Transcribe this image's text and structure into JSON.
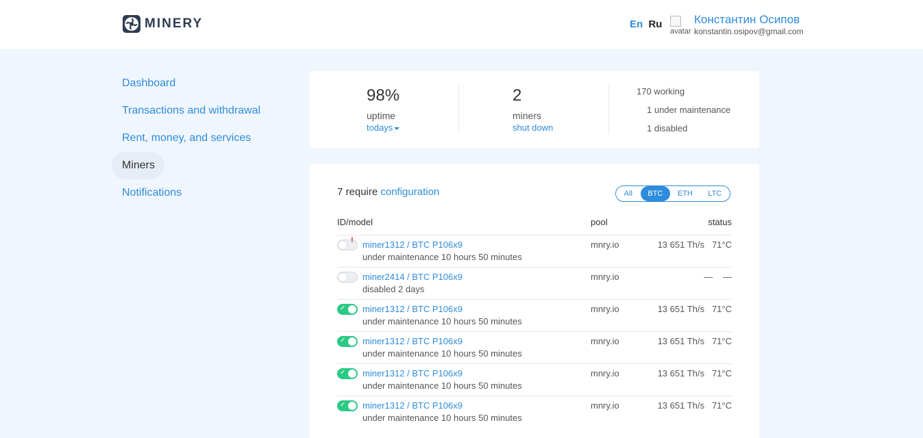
{
  "header": {
    "logo_text": "MINERY",
    "lang_en": "En",
    "lang_ru": "Ru",
    "avatar_alt": "avatar",
    "user_name": "Константин Осипов",
    "user_email": "konstantin.osipov@gmail.com"
  },
  "nav": {
    "items": [
      {
        "label": "Dashboard"
      },
      {
        "label": "Transactions and withdrawal"
      },
      {
        "label": "Rent, money, and services"
      },
      {
        "label": "Miners"
      },
      {
        "label": "Notifications"
      }
    ],
    "active": "Miners"
  },
  "stats": {
    "uptime_value": "98%",
    "uptime_label": "uptime",
    "uptime_period": "todays",
    "miners_value": "2",
    "miners_label": "miners",
    "miners_state": "shut down",
    "working": "170 working",
    "maintenance": "1 under maintenance",
    "disabled": "1 disabled"
  },
  "list": {
    "require_prefix": "7 require",
    "require_link": "configuration",
    "filters": [
      "All",
      "BTC",
      "ETH",
      "LTC"
    ],
    "active_filter": "BTC",
    "col_id": "ID/model",
    "col_pool": "pool",
    "col_status": "status",
    "rows": [
      {
        "enabled": false,
        "warning": "!",
        "name": "miner1312 / BTC P106x9",
        "status": "under maintenance 10 hours 50 minutes",
        "pool": "mnry.io",
        "hashrate": "13 651 Th/s",
        "temp": "71°C"
      },
      {
        "enabled": false,
        "warning": "",
        "name": "miner2414 / BTC P106x9",
        "status": "disabled 2 days",
        "pool": "mnry.io",
        "hashrate": "—",
        "temp": "—"
      },
      {
        "enabled": true,
        "warning": "",
        "name": "miner1312 / BTC P106x9",
        "status": "under maintenance 10 hours 50 minutes",
        "pool": "mnry.io",
        "hashrate": "13 651 Th/s",
        "temp": "71°C"
      },
      {
        "enabled": true,
        "warning": "",
        "name": "miner1312 / BTC P106x9",
        "status": "under maintenance 10 hours 50 minutes",
        "pool": "mnry.io",
        "hashrate": "13 651 Th/s",
        "temp": "71°C"
      },
      {
        "enabled": true,
        "warning": "",
        "name": "miner1312 / BTC P106x9",
        "status": "under maintenance 10 hours 50 minutes",
        "pool": "mnry.io",
        "hashrate": "13 651 Th/s",
        "temp": "71°C"
      },
      {
        "enabled": true,
        "warning": "",
        "name": "miner1312 / BTC P106x9",
        "status": "under maintenance 10 hours 50 minutes",
        "pool": "mnry.io",
        "hashrate": "13 651 Th/s",
        "temp": "71°C"
      }
    ]
  },
  "colors": {
    "accent": "#2d8cdb",
    "toggle_on": "#2bc985",
    "warning": "#c0392b",
    "background": "#f0f6fd"
  }
}
